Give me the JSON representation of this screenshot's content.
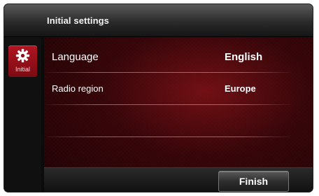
{
  "header": {
    "title": "Initial settings"
  },
  "sidebar": {
    "tab": {
      "label": "Initial",
      "icon": "gear-icon",
      "color": "#a6111c"
    }
  },
  "settings": {
    "rows": [
      {
        "label": "Language",
        "value": "English"
      },
      {
        "label": "Radio region",
        "value": "Europe"
      }
    ]
  },
  "footer": {
    "finish_label": "Finish"
  }
}
